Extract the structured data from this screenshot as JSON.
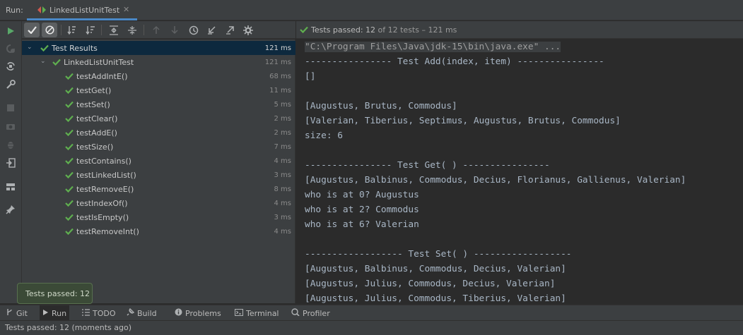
{
  "header": {
    "run_label": "Run:",
    "tab_title": "LinkedListUnitTest",
    "tab_close": "✕"
  },
  "status": {
    "prefix": "Tests passed: ",
    "passed": "12",
    "suffix": " of 12 tests – 121 ms"
  },
  "tree": {
    "root": {
      "label": "Test Results",
      "duration": "121 ms"
    },
    "suite": {
      "label": "LinkedListUnitTest",
      "duration": "121 ms"
    },
    "tests": [
      {
        "label": "testAddIntE()",
        "duration": "68 ms"
      },
      {
        "label": "testGet()",
        "duration": "11 ms"
      },
      {
        "label": "testSet()",
        "duration": "5 ms"
      },
      {
        "label": "testClear()",
        "duration": "2 ms"
      },
      {
        "label": "testAddE()",
        "duration": "2 ms"
      },
      {
        "label": "testSize()",
        "duration": "7 ms"
      },
      {
        "label": "testContains()",
        "duration": "4 ms"
      },
      {
        "label": "testLinkedList()",
        "duration": "3 ms"
      },
      {
        "label": "testRemoveE()",
        "duration": "8 ms"
      },
      {
        "label": "testIndexOf()",
        "duration": "4 ms"
      },
      {
        "label": "testIsEmpty()",
        "duration": "3 ms"
      },
      {
        "label": "testRemoveInt()",
        "duration": "4 ms"
      }
    ]
  },
  "console": {
    "lines": [
      "\"C:\\Program Files\\Java\\jdk-15\\bin\\java.exe\" ...",
      "---------------- Test Add(index, item) ----------------",
      "[]",
      "",
      "[Augustus, Brutus, Commodus]",
      "[Valerian, Tiberius, Septimus, Augustus, Brutus, Commodus]",
      "size: 6",
      "",
      "---------------- Test Get( ) ----------------",
      "[Augustus, Balbinus, Commodus, Decius, Florianus, Gallienus, Valerian]",
      "who is at 0? Augustus",
      "who is at 2? Commodus",
      "who is at 6? Valerian",
      "",
      "------------------ Test Set( ) ------------------",
      "[Augustus, Balbinus, Commodus, Decius, Valerian]",
      "[Augustus, Julius, Commodus, Decius, Valerian]",
      "[Augustus, Julius, Commodus, Tiberius, Valerian]"
    ]
  },
  "tooltip": "Tests passed: 12",
  "bottom_tabs": [
    {
      "label": "Git",
      "icon": "branch-icon"
    },
    {
      "label": "Run",
      "icon": "play-icon"
    },
    {
      "label": "TODO",
      "icon": "list-icon"
    },
    {
      "label": "Build",
      "icon": "hammer-icon"
    },
    {
      "label": "Problems",
      "icon": "info-icon"
    },
    {
      "label": "Terminal",
      "icon": "terminal-icon"
    },
    {
      "label": "Profiler",
      "icon": "profiler-icon"
    }
  ],
  "status_bar": "Tests passed: 12 (moments ago)",
  "colors": {
    "pass_green": "#5faf4f",
    "selection": "#0d293e",
    "accent_blue": "#4a88c7"
  }
}
